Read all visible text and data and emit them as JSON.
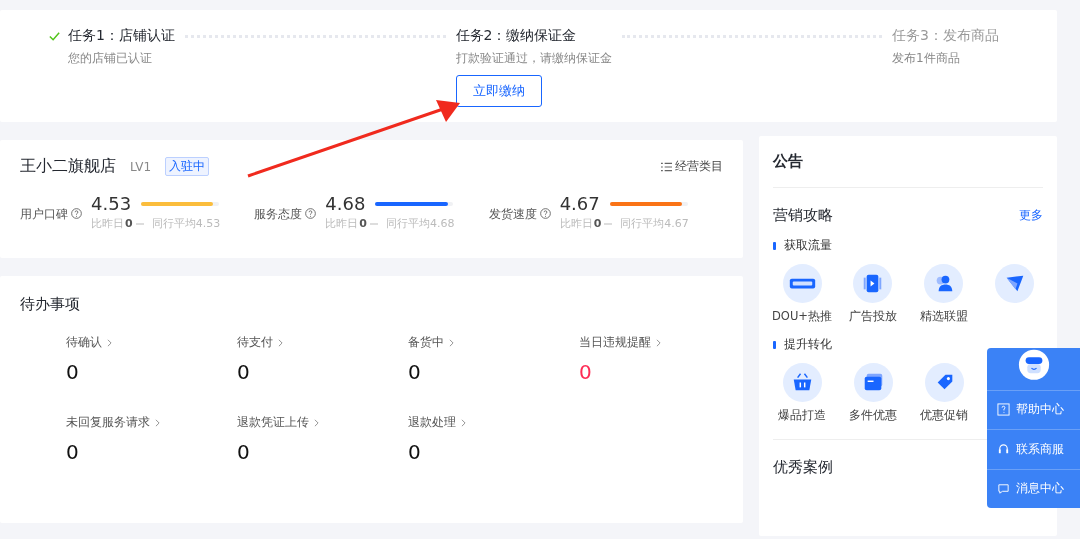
{
  "steps": [
    {
      "title": "任务1：店铺认证",
      "desc": "您的店铺已认证",
      "completed": true,
      "pending": false
    },
    {
      "title": "任务2：缴纳保证金",
      "desc": "打款验证通过，请缴纳保证金",
      "completed": false,
      "pending": false,
      "button": "立即缴纳"
    },
    {
      "title": "任务3：发布商品",
      "desc": "发布1件商品",
      "completed": false,
      "pending": true
    }
  ],
  "store": {
    "name": "王小二旗舰店",
    "level": "LV1",
    "status": "入驻中",
    "category_link": "经营类目",
    "metrics": [
      {
        "label": "用户口碑",
        "score": "4.53",
        "level": 0.92,
        "color": "#fbbd3c",
        "change_label": "比昨日",
        "change": "0",
        "avg": "同行平均4.53"
      },
      {
        "label": "服务态度",
        "score": "4.68",
        "level": 0.93,
        "color": "#1966ff",
        "change_label": "比昨日",
        "change": "0",
        "avg": "同行平均4.68"
      },
      {
        "label": "发货速度",
        "score": "4.67",
        "level": 0.93,
        "color": "#fa7316",
        "change_label": "比昨日",
        "change": "0",
        "avg": "同行平均4.67"
      }
    ]
  },
  "todo": {
    "title": "待办事项",
    "items": [
      {
        "label": "待确认",
        "count": "0",
        "alert": false
      },
      {
        "label": "待支付",
        "count": "0",
        "alert": false
      },
      {
        "label": "备货中",
        "count": "0",
        "alert": false
      },
      {
        "label": "当日违规提醒",
        "count": "0",
        "alert": true
      },
      {
        "label": "未回复服务请求",
        "count": "0",
        "alert": false
      },
      {
        "label": "退款凭证上传",
        "count": "0",
        "alert": false
      },
      {
        "label": "退款处理",
        "count": "0",
        "alert": false
      }
    ]
  },
  "side": {
    "notice_title": "公告",
    "marketing_title": "营销攻略",
    "more": "更多",
    "sections": [
      {
        "title": "获取流量",
        "tools": [
          {
            "kind": "dou",
            "label": "DOU+热推"
          },
          {
            "kind": "video",
            "label": "广告投放"
          },
          {
            "kind": "person",
            "label": "精选联盟"
          },
          {
            "kind": "plane"
          }
        ]
      },
      {
        "title": "提升转化",
        "tools": [
          {
            "kind": "basket",
            "label": "爆品打造"
          },
          {
            "kind": "card",
            "label": "多件优惠"
          },
          {
            "kind": "tag",
            "label": "优惠促销"
          }
        ]
      }
    ],
    "cases_title": "优秀案例"
  },
  "help_panel": {
    "items": [
      {
        "kind": "help",
        "label": "帮助中心"
      },
      {
        "kind": "service",
        "label": "联系商服"
      },
      {
        "kind": "message",
        "label": "消息中心"
      }
    ]
  }
}
